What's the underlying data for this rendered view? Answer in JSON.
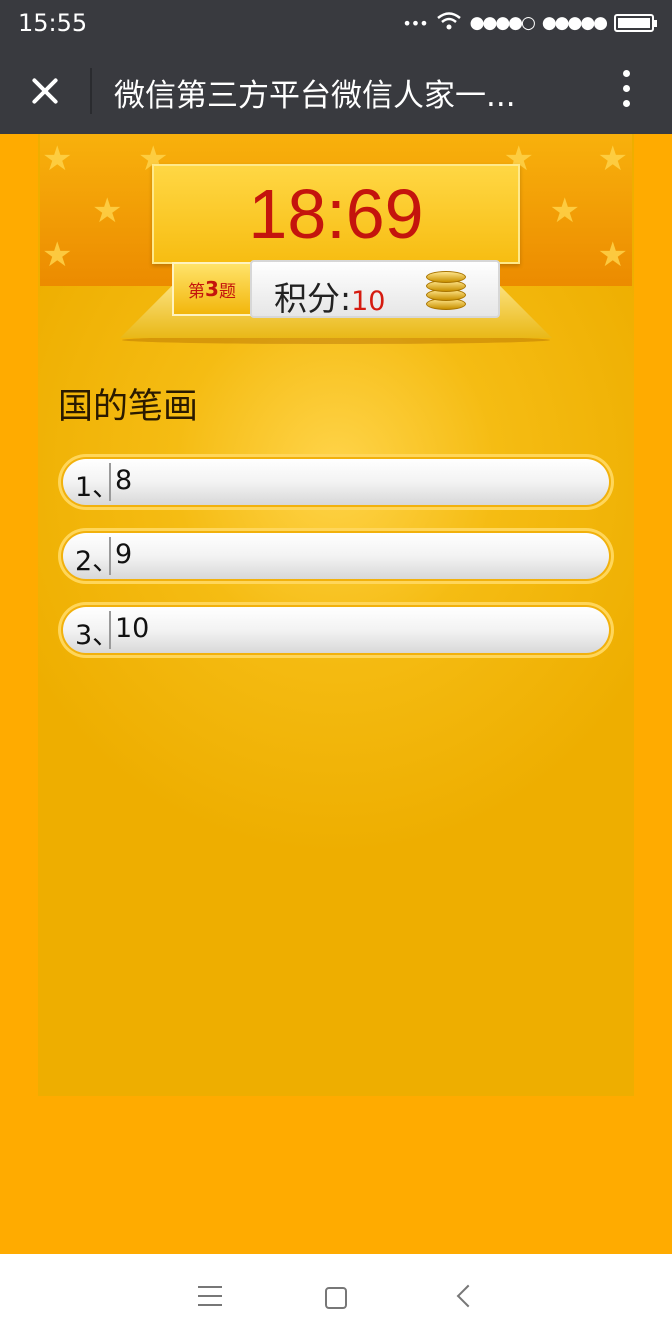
{
  "status_bar": {
    "time": "15:55",
    "signal_1": "●●●●○",
    "signal_2": "●●●●●"
  },
  "title_bar": {
    "title": "微信第三方平台微信人家一..."
  },
  "game": {
    "timer": "18:69",
    "question_tag": {
      "prefix": "第",
      "number": "3",
      "suffix": "题"
    },
    "score": {
      "label": "积分:",
      "value": "10"
    },
    "question": "国的笔画",
    "options": [
      {
        "label": "1、",
        "value": "8"
      },
      {
        "label": "2、",
        "value": "9"
      },
      {
        "label": "3、",
        "value": "10"
      }
    ]
  },
  "colors": {
    "background": "#ffab00",
    "timer": "#c4140d",
    "score_value": "#d51b10",
    "bar": "#393a3f"
  }
}
